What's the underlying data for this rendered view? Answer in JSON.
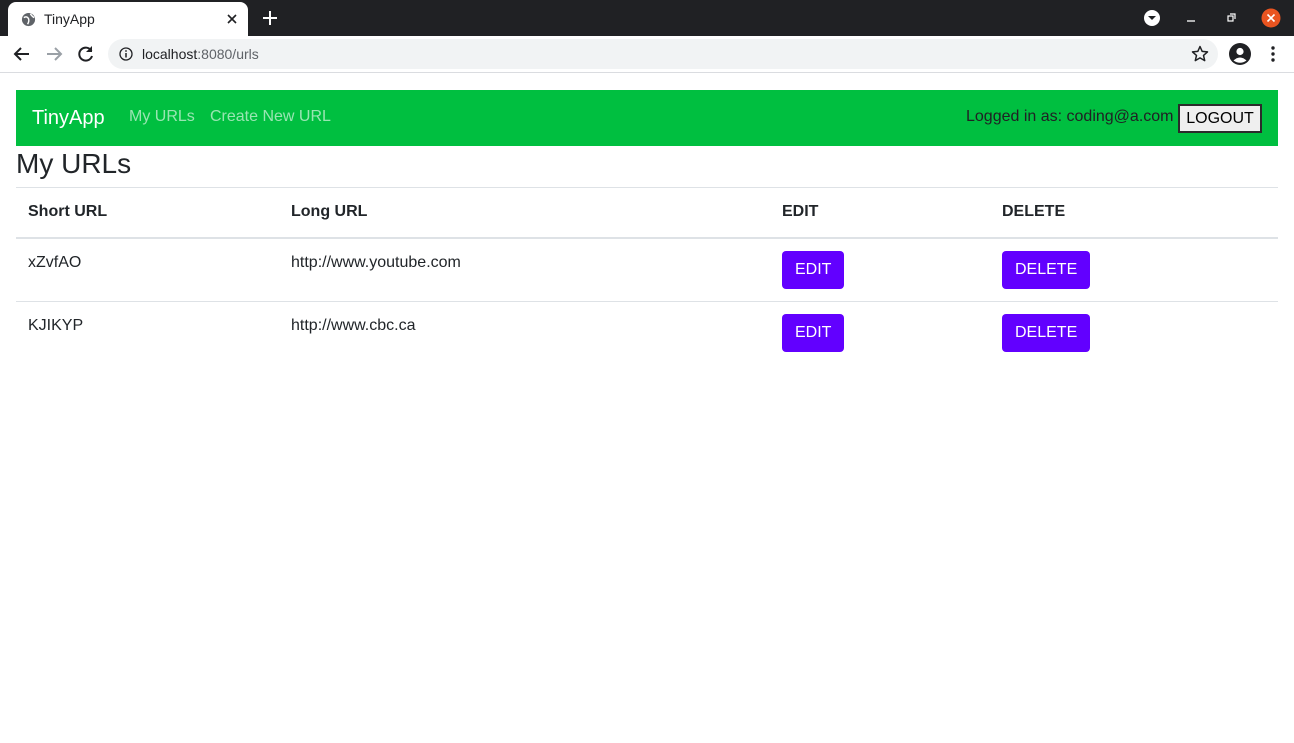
{
  "browser": {
    "tab_title": "TinyApp",
    "url_host": "localhost",
    "url_path": ":8080/urls"
  },
  "navbar": {
    "brand": "TinyApp",
    "links": [
      "My URLs",
      "Create New URL"
    ],
    "logged_in_text": "Logged in as: coding@a.com",
    "logout_label": "LOGOUT",
    "color": "#00bf40"
  },
  "main": {
    "heading": "My URLs",
    "table": {
      "headers": [
        "Short URL",
        "Long URL",
        "EDIT",
        "DELETE"
      ],
      "rows": [
        {
          "short": "xZvfAO",
          "long": "http://www.youtube.com",
          "edit_label": "EDIT",
          "delete_label": "DELETE"
        },
        {
          "short": "KJIKYP",
          "long": "http://www.cbc.ca",
          "edit_label": "EDIT",
          "delete_label": "DELETE"
        }
      ]
    },
    "button_color": "#6200ff"
  }
}
